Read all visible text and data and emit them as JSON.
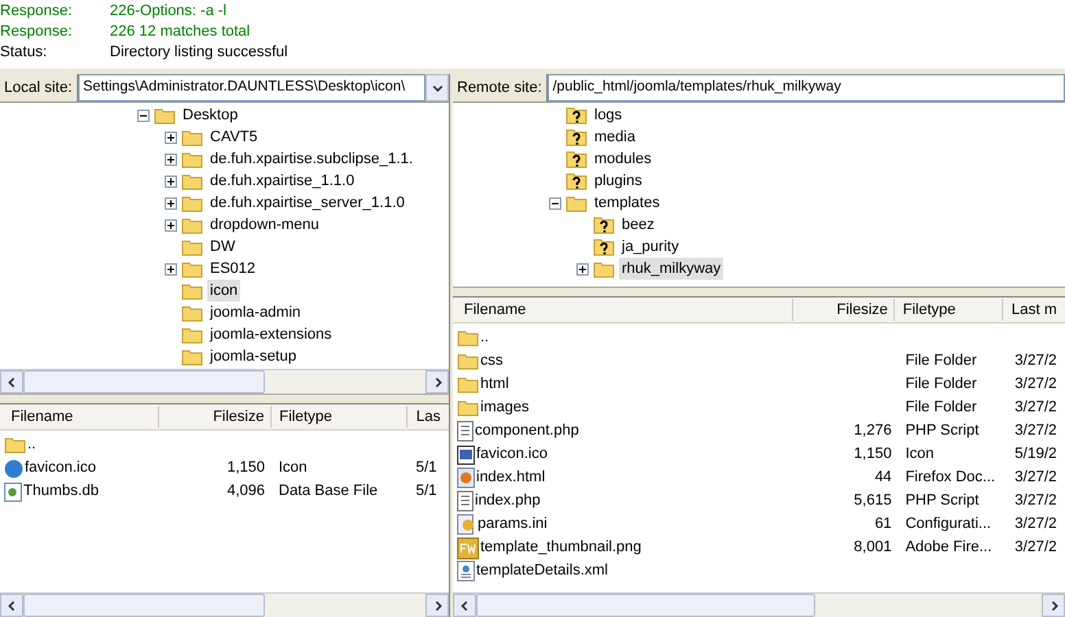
{
  "log": [
    {
      "label": "Response:",
      "message": "226-Options: -a -l",
      "kind": "response"
    },
    {
      "label": "Response:",
      "message": "226 12 matches total",
      "kind": "response"
    },
    {
      "label": "Status:",
      "message": "Directory listing successful",
      "kind": "status"
    }
  ],
  "local": {
    "label": "Local site:",
    "path": "Settings\\Administrator.DAUNTLESS\\Desktop\\icon\\",
    "tree": [
      {
        "name": "Desktop",
        "kind": "folder",
        "expanded": true,
        "selected": false,
        "children": [
          {
            "name": "CAVT5",
            "kind": "folder",
            "expanded": false,
            "selected": false
          },
          {
            "name": "de.fuh.xpairtise.subclipse_1.1.",
            "kind": "folder",
            "expanded": false,
            "selected": false
          },
          {
            "name": "de.fuh.xpairtise_1.1.0",
            "kind": "folder",
            "expanded": false,
            "selected": false
          },
          {
            "name": "de.fuh.xpairtise_server_1.1.0",
            "kind": "folder",
            "expanded": false,
            "selected": false
          },
          {
            "name": "dropdown-menu",
            "kind": "folder",
            "expanded": false,
            "selected": false
          },
          {
            "name": "DW",
            "kind": "folder",
            "selected": false
          },
          {
            "name": "ES012",
            "kind": "folder",
            "expanded": false,
            "selected": false
          },
          {
            "name": "icon",
            "kind": "folder",
            "selected": true
          },
          {
            "name": "joomla-admin",
            "kind": "folder",
            "selected": false
          },
          {
            "name": "joomla-extensions",
            "kind": "folder",
            "selected": false
          },
          {
            "name": "joomla-setup",
            "kind": "folder",
            "selected": false
          }
        ]
      }
    ],
    "columns": [
      "Filename",
      "Filesize",
      "Filetype",
      "Las"
    ],
    "files": [
      {
        "name": "..",
        "kind": "folder"
      },
      {
        "name": "favicon.ico",
        "kind": "globe",
        "size": "1,150",
        "type": "Icon",
        "modified": "5/1"
      },
      {
        "name": "Thumbs.db",
        "kind": "database",
        "size": "4,096",
        "type": "Data Base File",
        "modified": "5/1"
      }
    ]
  },
  "remote": {
    "label": "Remote site:",
    "path": "/public_html/joomla/templates/rhuk_milkyway",
    "tree": [
      {
        "name": "logs",
        "kind": "unknown",
        "selected": false
      },
      {
        "name": "media",
        "kind": "unknown",
        "selected": false
      },
      {
        "name": "modules",
        "kind": "unknown",
        "selected": false
      },
      {
        "name": "plugins",
        "kind": "unknown",
        "selected": false
      },
      {
        "name": "templates",
        "kind": "folder",
        "expanded": true,
        "selected": false,
        "children": [
          {
            "name": "beez",
            "kind": "unknown",
            "selected": false
          },
          {
            "name": "ja_purity",
            "kind": "unknown",
            "selected": false
          },
          {
            "name": "rhuk_milkyway",
            "kind": "folder",
            "expanded": false,
            "selected": true
          }
        ]
      }
    ],
    "columns": [
      "Filename",
      "Filesize",
      "Filetype",
      "Last m"
    ],
    "files": [
      {
        "name": "..",
        "kind": "folder"
      },
      {
        "name": "css",
        "kind": "folder",
        "type": "File Folder",
        "modified": "3/27/2"
      },
      {
        "name": "html",
        "kind": "folder",
        "type": "File Folder",
        "modified": "3/27/2"
      },
      {
        "name": "images",
        "kind": "folder",
        "type": "File Folder",
        "modified": "3/27/2"
      },
      {
        "name": "component.php",
        "kind": "script",
        "size": "1,276",
        "type": "PHP Script",
        "modified": "3/27/2"
      },
      {
        "name": "favicon.ico",
        "kind": "icofile",
        "size": "1,150",
        "type": "Icon",
        "modified": "5/19/2"
      },
      {
        "name": "index.html",
        "kind": "webdoc",
        "size": "44",
        "type": "Firefox Doc...",
        "modified": "3/27/2"
      },
      {
        "name": "index.php",
        "kind": "script",
        "size": "5,615",
        "type": "PHP Script",
        "modified": "3/27/2"
      },
      {
        "name": "params.ini",
        "kind": "settings",
        "size": "61",
        "type": "Configurati...",
        "modified": "3/27/2"
      },
      {
        "name": "template_thumbnail.png",
        "kind": "image",
        "size": "8,001",
        "type": "Adobe Fire...",
        "modified": "3/27/2"
      },
      {
        "name": "templateDetails.xml",
        "kind": "xml"
      }
    ]
  }
}
